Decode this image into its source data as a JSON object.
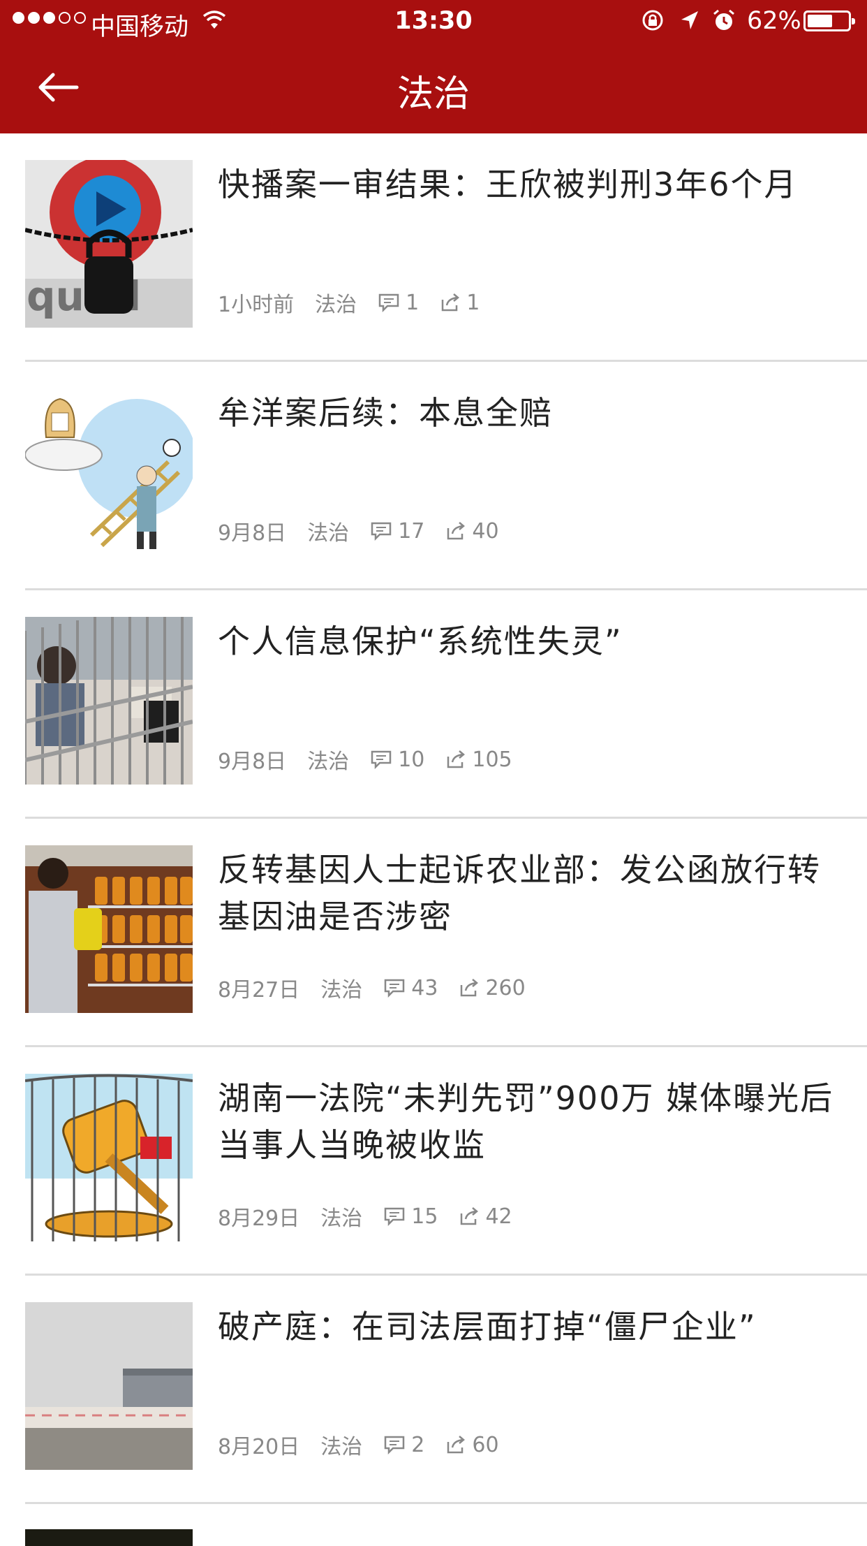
{
  "status_bar": {
    "carrier": "中国移动",
    "time": "13:30",
    "battery": "62%",
    "battery_level": 0.62,
    "signal_bars": 3
  },
  "nav": {
    "title": "法治",
    "back_icon": "back-arrow-icon"
  },
  "colors": {
    "header_bg": "#a80f0f",
    "meta_text": "#888888",
    "divider": "#dcdcdc"
  },
  "articles": [
    {
      "title": "快播案一审结果：王欣被判刑3年6个月",
      "date": "1小时前",
      "category": "法治",
      "comments": "1",
      "shares": "1",
      "thumb": "qvod-lock-thumbnail"
    },
    {
      "title": "牟洋案后续：本息全赔",
      "date": "9月8日",
      "category": "法治",
      "comments": "17",
      "shares": "40",
      "thumb": "cartoon-ladder-thumbnail"
    },
    {
      "title": "个人信息保护“系统性失灵”",
      "date": "9月8日",
      "category": "法治",
      "comments": "10",
      "shares": "105",
      "thumb": "courtroom-cage-thumbnail"
    },
    {
      "title": "反转基因人士起诉农业部：发公函放行转基因油是否涉密",
      "date": "8月27日",
      "category": "法治",
      "comments": "43",
      "shares": "260",
      "thumb": "supermarket-oil-thumbnail"
    },
    {
      "title": "湖南一法院“未判先罚”900万 媒体曝光后当事人当晚被收监",
      "date": "8月29日",
      "category": "法治",
      "comments": "15",
      "shares": "42",
      "thumb": "gavel-cage-cartoon-thumbnail"
    },
    {
      "title": "破产庭：在司法层面打掉“僵尸企业”",
      "date": "8月20日",
      "category": "法治",
      "comments": "2",
      "shares": "60",
      "thumb": "factory-thumbnail"
    }
  ]
}
